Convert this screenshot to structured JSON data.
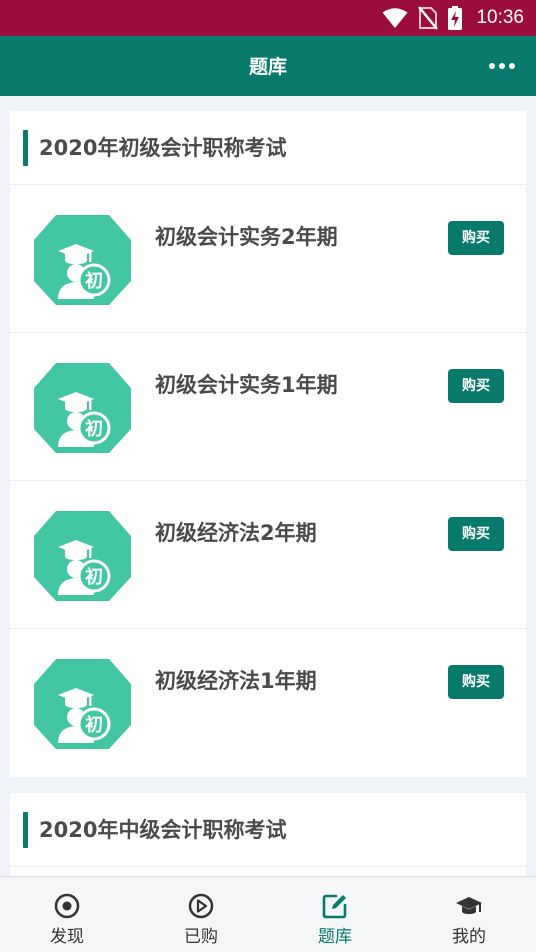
{
  "status_bar": {
    "time": "10:36"
  },
  "app_bar": {
    "title": "题库"
  },
  "sections": [
    {
      "title": "2020年初级会计职称考试",
      "items": [
        {
          "title": "初级会计实务2年期",
          "badge": "初",
          "button": "购买"
        },
        {
          "title": "初级会计实务1年期",
          "badge": "初",
          "button": "购买"
        },
        {
          "title": "初级经济法2年期",
          "badge": "初",
          "button": "购买"
        },
        {
          "title": "初级经济法1年期",
          "badge": "初",
          "button": "购买"
        }
      ]
    },
    {
      "title": "2020年中级会计职称考试",
      "items": []
    }
  ],
  "bottom_nav": [
    {
      "label": "发现",
      "icon": "discover-icon"
    },
    {
      "label": "已购",
      "icon": "play-circle-icon"
    },
    {
      "label": "题库",
      "icon": "edit-icon",
      "active": true
    },
    {
      "label": "我的",
      "icon": "graduation-cap-icon"
    }
  ],
  "colors": {
    "status_bar": "#9b0d3a",
    "primary": "#087a6c",
    "icon_green": "#43c6a4",
    "background": "#f0f3f7"
  }
}
